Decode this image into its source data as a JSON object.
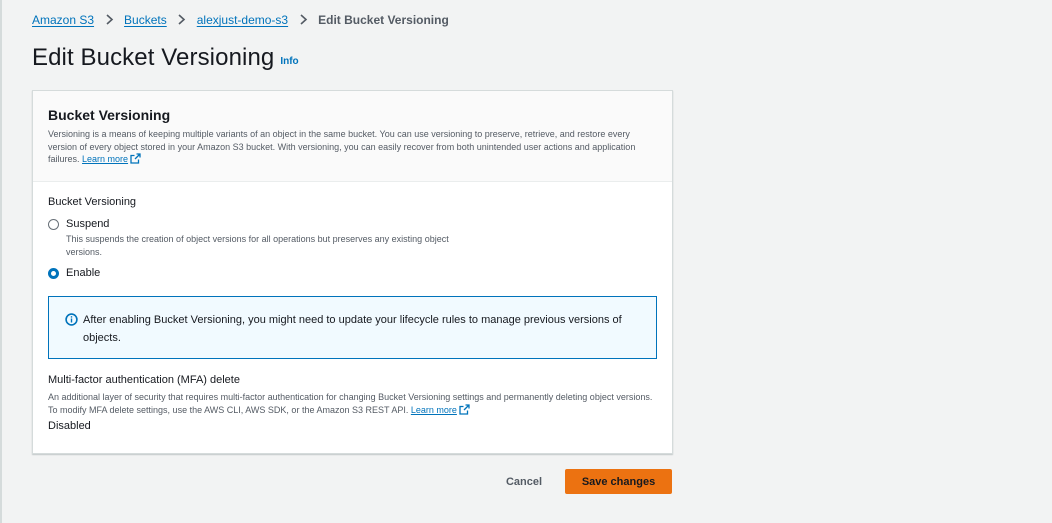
{
  "breadcrumb": {
    "items": [
      "Amazon S3",
      "Buckets",
      "alexjust-demo-s3"
    ],
    "current": "Edit Bucket Versioning"
  },
  "page": {
    "title": "Edit Bucket Versioning",
    "info": "Info"
  },
  "section": {
    "title": "Bucket Versioning",
    "description": "Versioning is a means of keeping multiple variants of an object in the same bucket. You can use versioning to preserve, retrieve, and restore every version of every object stored in your Amazon S3 bucket. With versioning, you can easily recover from both unintended user actions and application failures.",
    "learn_more": "Learn more"
  },
  "versioning": {
    "label": "Bucket Versioning",
    "options": [
      {
        "label": "Suspend",
        "description": "This suspends the creation of object versions for all operations but preserves any existing object versions.",
        "checked": false
      },
      {
        "label": "Enable",
        "description": "",
        "checked": true
      }
    ]
  },
  "alert": {
    "text": "After enabling Bucket Versioning, you might need to update your lifecycle rules to manage previous versions of objects."
  },
  "mfa": {
    "label": "Multi-factor authentication (MFA) delete",
    "description": "An additional layer of security that requires multi-factor authentication for changing Bucket Versioning settings and permanently deleting object versions. To modify MFA delete settings, use the AWS CLI, AWS SDK, or the Amazon S3 REST API.",
    "learn_more": "Learn more",
    "value": "Disabled"
  },
  "actions": {
    "cancel": "Cancel",
    "save": "Save changes"
  },
  "colors": {
    "link": "#0073bb",
    "primary_button": "#ec7211",
    "alert_border": "#0073bb",
    "background": "#f2f3f3"
  },
  "icons": [
    "chevron-right-icon",
    "external-link-icon",
    "info-circle-icon"
  ]
}
